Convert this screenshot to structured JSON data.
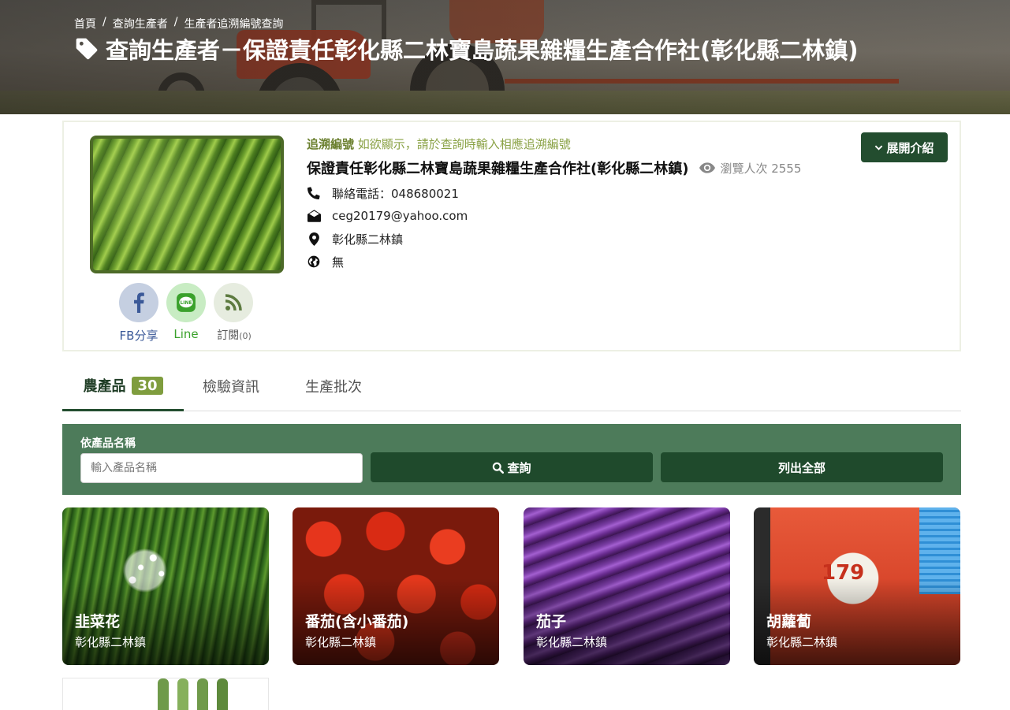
{
  "breadcrumb": [
    "首頁",
    "查詢生產者",
    "生產者追溯編號查詢"
  ],
  "page_title": "查詢生產者－保證責任彰化縣二林寶島蔬果雜糧生產合作社(彰化縣二林鎮)",
  "profile": {
    "trace_label": "追溯編號",
    "trace_note": "如欲顯示，請於查詢時輸入相應追溯編號",
    "name": "保證責任彰化縣二林寶島蔬果雜糧生產合作社(彰化縣二林鎮)",
    "views_text": "瀏覽人次 2555",
    "phone": "聯絡電話：048680021",
    "email": "ceg20179@yahoo.com",
    "address": "彰化縣二林鎮",
    "website": "無",
    "expand_label": "展開介紹"
  },
  "share": {
    "fb_label": "FB分享",
    "line_label": "Line",
    "subscribe_label": "訂閱",
    "subscribe_count": "(0)"
  },
  "tabs": [
    {
      "label": "農產品",
      "badge": "30",
      "active": true
    },
    {
      "label": "檢驗資訊",
      "active": false
    },
    {
      "label": "生產批次",
      "active": false
    }
  ],
  "search": {
    "label": "依產品名稱",
    "placeholder": "輸入產品名稱",
    "search_button": "查詢",
    "list_all_button": "列出全部"
  },
  "products": [
    {
      "name": "韭菜花",
      "location": "彰化縣二林鎮"
    },
    {
      "name": "番茄(含小番茄)",
      "location": "彰化縣二林鎮"
    },
    {
      "name": "茄子",
      "location": "彰化縣二林鎮"
    },
    {
      "name": "胡蘿蔔",
      "location": "彰化縣二林鎮"
    }
  ],
  "product4_bag_text": "179",
  "colors": {
    "primary_dark_green": "#234d2f",
    "search_panel_green": "#4d7b5a",
    "badge_olive": "#7f9d3e",
    "facebook_blue": "#3b5998",
    "line_green": "#3aa12b"
  }
}
